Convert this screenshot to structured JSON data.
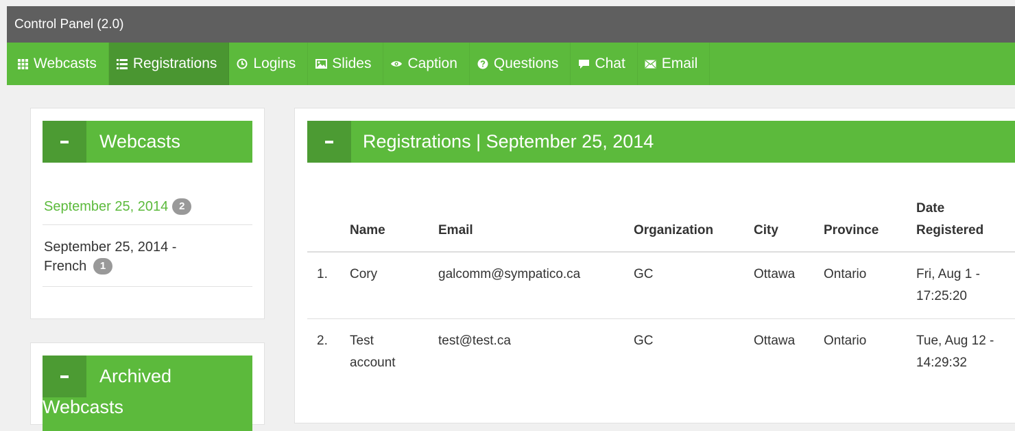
{
  "app": {
    "title": "Control Panel (2.0)"
  },
  "nav": {
    "items": [
      {
        "label": "Webcasts",
        "icon": "grid-icon",
        "active": false
      },
      {
        "label": "Registrations",
        "icon": "list-icon",
        "active": true
      },
      {
        "label": "Logins",
        "icon": "clock-icon",
        "active": false
      },
      {
        "label": "Slides",
        "icon": "picture-icon",
        "active": false
      },
      {
        "label": "Caption",
        "icon": "eye-icon",
        "active": false
      },
      {
        "label": "Questions",
        "icon": "question-circle-icon",
        "active": false
      },
      {
        "label": "Chat",
        "icon": "chat-bubble-icon",
        "active": false
      },
      {
        "label": "Email",
        "icon": "envelope-icon",
        "active": false
      }
    ]
  },
  "sidebar": {
    "webcasts_title": "Webcasts",
    "collapse_symbol": "-",
    "webcasts": [
      {
        "label": "September 25, 2014",
        "count": "2",
        "current": true
      },
      {
        "label": "September 25, 2014 - French",
        "count": "1",
        "current": false
      }
    ],
    "archived_title": "Archived Webcasts"
  },
  "main": {
    "title": "Registrations | September 25, 2014",
    "table": {
      "headers": {
        "name": "Name",
        "email": "Email",
        "organization": "Organization",
        "city": "City",
        "province": "Province",
        "date_line1": "Date",
        "date_line2": "Registered"
      },
      "rows": [
        {
          "num": "1.",
          "name_line1": "Cory",
          "name_line2": "",
          "email": "galcomm@sympatico.ca",
          "organization": "GC",
          "city": "Ottawa",
          "province": "Ontario",
          "date_line1": "Fri, Aug 1 -",
          "date_line2": "17:25:20"
        },
        {
          "num": "2.",
          "name_line1": "Test",
          "name_line2": "account",
          "email": "test@test.ca",
          "organization": "GC",
          "city": "Ottawa",
          "province": "Ontario",
          "date_line1": "Tue, Aug 12 -",
          "date_line2": "14:29:32"
        }
      ]
    }
  },
  "colors": {
    "brand_green": "#5cba3c",
    "active_green": "#4a9631",
    "titlebar_gray": "#5f5f5f",
    "badge_gray": "#999999"
  }
}
